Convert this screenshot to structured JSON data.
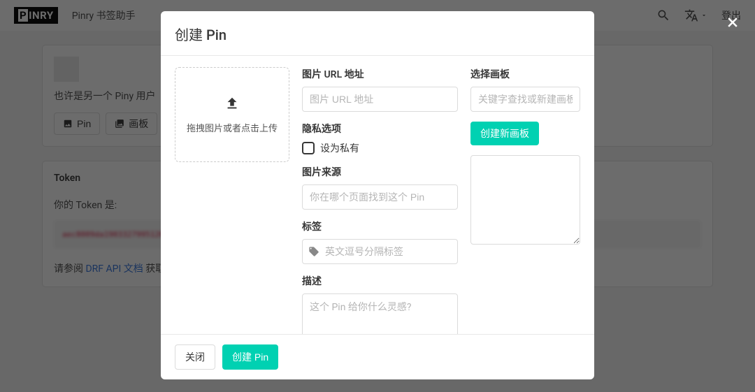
{
  "nav": {
    "brand": "PINRY",
    "link_bookmarklet": "Pinry 书签助手",
    "logout": "登出"
  },
  "profile": {
    "text": "也许是另一个 Piny 用户",
    "btn_pin": "Pin",
    "btn_board": "画板"
  },
  "token": {
    "title": "Token",
    "label": "你的 Token 是:",
    "value": "aec8009da19033279951262......",
    "help_prefix": "请参阅 ",
    "help_link": "DRF API 文档",
    "help_suffix": " 获取更..."
  },
  "modal": {
    "title": "创建 Pin",
    "dropzone": "拖拽图片或者点击上传",
    "labels": {
      "image_url": "图片 URL 地址",
      "privacy": "隐私选项",
      "private": "设为私有",
      "referer": "图片来源",
      "tags": "标签",
      "description": "描述",
      "board": "选择画板"
    },
    "placeholders": {
      "image_url": "图片 URL 地址",
      "referer": "你在哪个页面找到这个 Pin",
      "tags": "英文逗号分隔标签",
      "description": "这个 Pin 给你什么灵感?",
      "board": "关键字查找或新建画板"
    },
    "btn_new_board": "创建新画板",
    "btn_close": "关闭",
    "btn_create": "创建 Pin"
  }
}
